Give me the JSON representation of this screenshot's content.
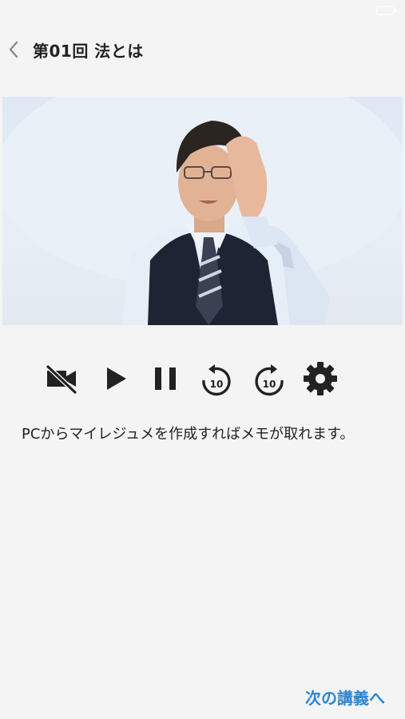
{
  "header": {
    "title": "第01回 法とは",
    "back_icon": "chevron-left-icon"
  },
  "video": {
    "content": "lecturer-video"
  },
  "controls": [
    {
      "name": "camera-off-icon"
    },
    {
      "name": "play-icon"
    },
    {
      "name": "pause-icon"
    },
    {
      "name": "rewind-10-icon",
      "label": "10"
    },
    {
      "name": "forward-10-icon",
      "label": "10"
    },
    {
      "name": "settings-gear-icon"
    }
  ],
  "info": {
    "text": "PCからマイレジュメを作成すればメモが取れます。"
  },
  "footer": {
    "next_label": "次の講義へ"
  },
  "colors": {
    "background": "#f4f4f4",
    "accent": "#2e86d1",
    "icon": "#222222"
  }
}
